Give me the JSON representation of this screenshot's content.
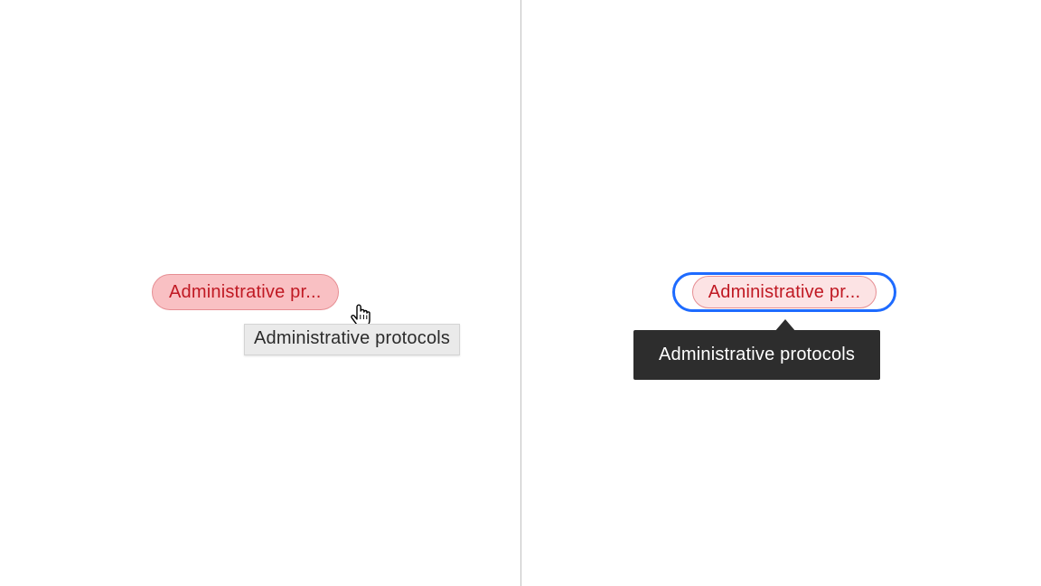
{
  "left": {
    "tag_label": "Administrative pr...",
    "tooltip_text": "Administrative protocols"
  },
  "right": {
    "tag_label": "Administrative pr...",
    "tooltip_text": "Administrative protocols"
  },
  "colors": {
    "tag_text": "#c01923",
    "tag_fill_hover": "#f9c0c3",
    "tag_fill_default": "#fce3e4",
    "tag_border": "#e68e93",
    "focus_ring": "#1e6bff",
    "tooltip_dark_bg": "#2d2d2d",
    "tooltip_light_bg": "#eaeaea"
  }
}
